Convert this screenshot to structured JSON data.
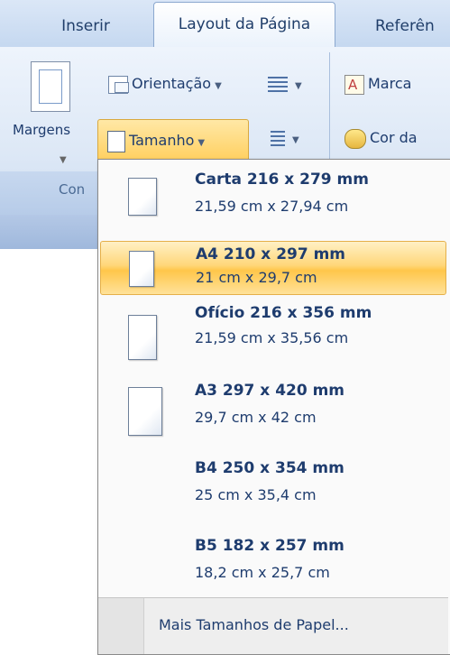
{
  "tabs": [
    {
      "label": "Inserir",
      "active": false
    },
    {
      "label": "Layout da Página",
      "active": true
    },
    {
      "label": "Referên",
      "active": false
    }
  ],
  "ribbon": {
    "margins_label": "Margens",
    "orientation_label": "Orientação",
    "size_label": "Tamanho",
    "watermark_label": "Marca",
    "page_color_label": "Cor da",
    "group_label": "Con"
  },
  "menu": {
    "items": [
      {
        "title": "Carta 216 x 279 mm",
        "subtitle": "21,59 cm x 27,94 cm",
        "highlighted": false
      },
      {
        "title": "A4 210 x 297 mm",
        "subtitle": "21 cm x 29,7 cm",
        "highlighted": true
      },
      {
        "title": "Ofício 216 x 356 mm",
        "subtitle": "21,59 cm x 35,56 cm",
        "highlighted": false
      },
      {
        "title": "A3 297 x 420 mm",
        "subtitle": "29,7 cm x 42 cm",
        "highlighted": false
      },
      {
        "title": "B4 250 x 354 mm",
        "subtitle": "25 cm x 35,4 cm",
        "highlighted": false
      },
      {
        "title": "B5 182 x 257 mm",
        "subtitle": "18,2 cm x 25,7 cm",
        "highlighted": false
      }
    ],
    "more_sizes_label": "Mais Tamanhos de Papel..."
  },
  "colors": {
    "highlight": "#ffd77a",
    "text": "#1e3c6e",
    "ribbon": "#dde8f6"
  }
}
